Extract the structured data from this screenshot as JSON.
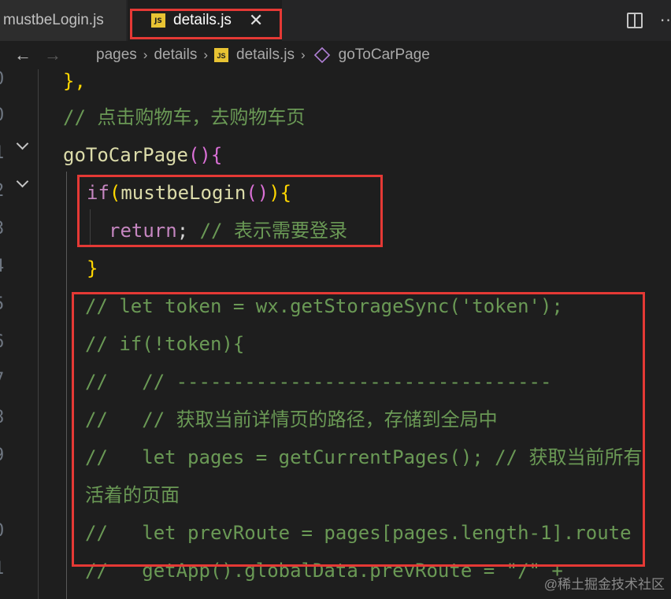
{
  "tabs": {
    "inactive_label": "mustbeLogin.js",
    "active_label": "details.js",
    "active_badge": "JS",
    "close_glyph": "✕"
  },
  "breadcrumb": {
    "back_glyph": "←",
    "forward_glyph": "→",
    "items": [
      "pages",
      "details",
      "details.js",
      "goToCarPage"
    ],
    "separator": "›",
    "file_badge": "JS"
  },
  "gutter": {
    "line_numbers": [
      "0",
      "0",
      "1",
      "2",
      "3",
      "4",
      "5",
      "6",
      "7",
      "8",
      "9",
      "0",
      "1"
    ]
  },
  "code": {
    "l1": "},",
    "l2": "// 点击购物车，去购物车页",
    "l3_func": "goToCarPage",
    "l3_paren": "()",
    "l3_brace": "{",
    "l4_kw": "if",
    "l4_open": "(",
    "l4_func": "mustbeLogin",
    "l4_call": "()",
    "l4_close": ")",
    "l4_brace": "{",
    "l5_kw": "return",
    "l5_semi": ";",
    "l5_comment": " // 表示需要登录",
    "l6": "}",
    "l7": "// let token = wx.getStorageSync('token');",
    "l8": "// if(!token){",
    "l9": "//   // ---------------------------------",
    "l10": "//   // 获取当前详情页的路径，存储到全局中",
    "l11": "//   let pages = getCurrentPages(); // 获取当前所有",
    "l12": "活着的页面",
    "l13": "//   let prevRoute = pages[pages.length-1].route",
    "l14": "//   getApp().globalData.prevRoute = \"/\" +"
  },
  "watermark": "@稀土掘金技术社区",
  "colors": {
    "highlight_box": "#e53935",
    "comment": "#6a9955",
    "function": "#dcdcaa",
    "keyword": "#c586c0"
  }
}
